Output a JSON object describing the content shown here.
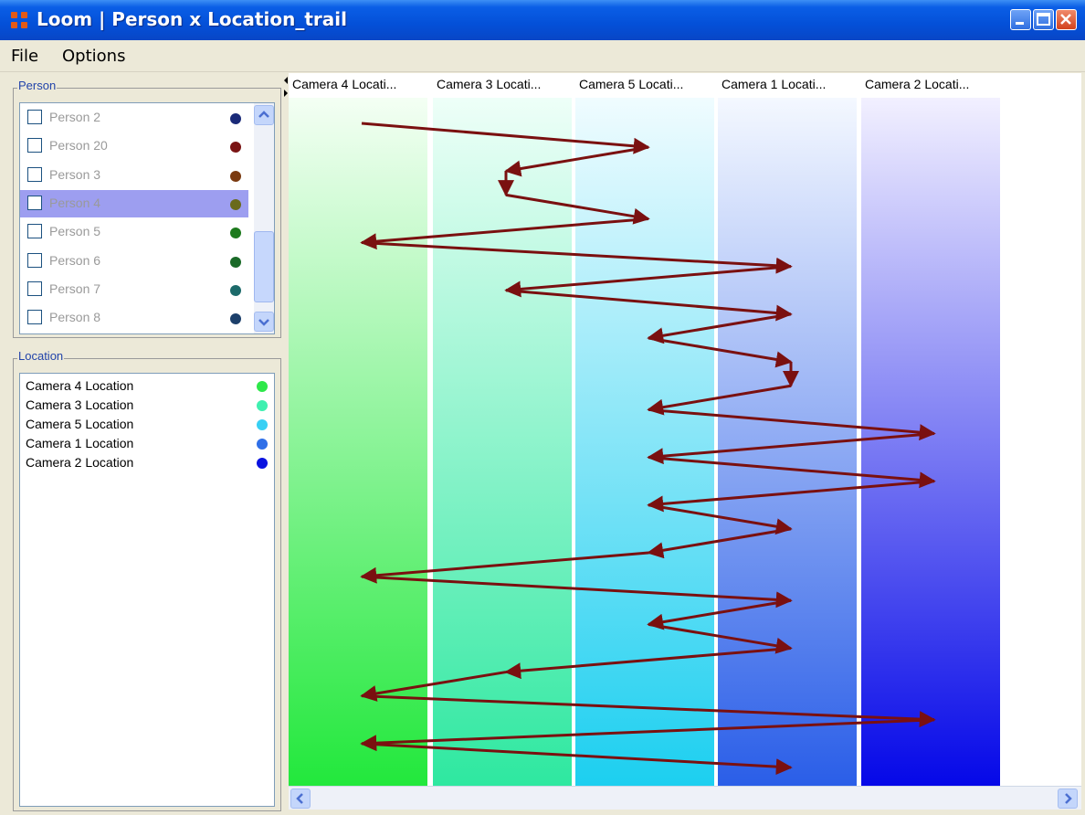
{
  "window": {
    "title": "Loom | Person x Location_trail",
    "controls": [
      "minimize-icon",
      "maximize-icon",
      "close-icon"
    ]
  },
  "menu": [
    "File",
    "Options"
  ],
  "person_panel": {
    "legend": "Person",
    "items": [
      {
        "label": "Person 2",
        "color": "#1a2a78",
        "selected": false
      },
      {
        "label": "Person 20",
        "color": "#7a1414",
        "selected": false
      },
      {
        "label": "Person 3",
        "color": "#7a3a10",
        "selected": false
      },
      {
        "label": "Person 4",
        "color": "#6a6a1c",
        "selected": true
      },
      {
        "label": "Person 5",
        "color": "#1d7a1d",
        "selected": false
      },
      {
        "label": "Person 6",
        "color": "#1a6a28",
        "selected": false
      },
      {
        "label": "Person 7",
        "color": "#1c6a6a",
        "selected": false
      },
      {
        "label": "Person 8",
        "color": "#1c3f6a",
        "selected": false
      }
    ]
  },
  "location_panel": {
    "legend": "Location",
    "items": [
      {
        "label": "Camera 4 Location",
        "color": "#2ee84a"
      },
      {
        "label": "Camera 3 Location",
        "color": "#3ff0b0"
      },
      {
        "label": "Camera 5 Location",
        "color": "#38d0f4"
      },
      {
        "label": "Camera 1 Location",
        "color": "#2f6fe8"
      },
      {
        "label": "Camera 2 Location",
        "color": "#0a12e0"
      }
    ]
  },
  "trail_view": {
    "columns": [
      {
        "header": "Camera 4 Locati...",
        "top_color": "#f4fff4",
        "bottom_color": "#22e83c"
      },
      {
        "header": "Camera 3 Locati...",
        "top_color": "#eefff8",
        "bottom_color": "#2ee8a0"
      },
      {
        "header": "Camera 5 Locati...",
        "top_color": "#f0fcff",
        "bottom_color": "#1ccff0"
      },
      {
        "header": "Camera 1 Locati...",
        "top_color": "#f4f8ff",
        "bottom_color": "#2a5ee8"
      },
      {
        "header": "Camera 2 Locati...",
        "top_color": "#f2f0ff",
        "bottom_color": "#0508e8"
      }
    ],
    "trail_color": "#7a1010",
    "trail": [
      {
        "step": 1,
        "camera": 4
      },
      {
        "step": 2,
        "camera": 5
      },
      {
        "step": 3,
        "camera": 3
      },
      {
        "step": 4,
        "camera": 3
      },
      {
        "step": 5,
        "camera": 5
      },
      {
        "step": 6,
        "camera": 4
      },
      {
        "step": 7,
        "camera": 1
      },
      {
        "step": 8,
        "camera": 3
      },
      {
        "step": 9,
        "camera": 1
      },
      {
        "step": 10,
        "camera": 5
      },
      {
        "step": 11,
        "camera": 1
      },
      {
        "step": 12,
        "camera": 1
      },
      {
        "step": 13,
        "camera": 5
      },
      {
        "step": 14,
        "camera": 2
      },
      {
        "step": 15,
        "camera": 5
      },
      {
        "step": 16,
        "camera": 2
      },
      {
        "step": 17,
        "camera": 5
      },
      {
        "step": 18,
        "camera": 1
      },
      {
        "step": 19,
        "camera": 5
      },
      {
        "step": 20,
        "camera": 4
      },
      {
        "step": 21,
        "camera": 1
      },
      {
        "step": 22,
        "camera": 5
      },
      {
        "step": 23,
        "camera": 1
      },
      {
        "step": 24,
        "camera": 3
      },
      {
        "step": 25,
        "camera": 4
      },
      {
        "step": 26,
        "camera": 2
      },
      {
        "step": 27,
        "camera": 4
      },
      {
        "step": 28,
        "camera": 1
      }
    ]
  }
}
